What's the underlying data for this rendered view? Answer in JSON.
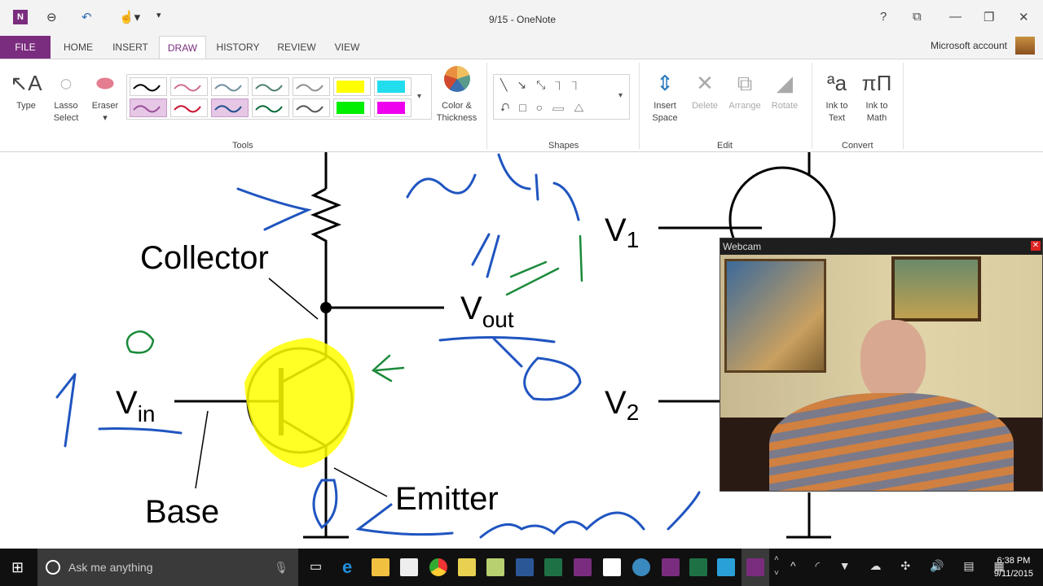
{
  "titlebar": {
    "title": "9/15 - OneNote",
    "help": "?",
    "account": "Microsoft account"
  },
  "tabs": [
    "FILE",
    "HOME",
    "INSERT",
    "DRAW",
    "HISTORY",
    "REVIEW",
    "VIEW"
  ],
  "ribbon": {
    "type": "Type",
    "lasso": "Lasso Select",
    "eraser": "Eraser",
    "color_thickness": "Color & Thickness",
    "insert_space": "Insert Space",
    "delete": "Delete",
    "arrange": "Arrange",
    "rotate": "Rotate",
    "ink_to_text": "Ink to Text",
    "ink_to_math": "Ink to Math",
    "groups": {
      "tools": "Tools",
      "shapes": "Shapes",
      "edit": "Edit",
      "convert": "Convert"
    },
    "pen_colors": [
      "#000000",
      "#d07090",
      "#7090a0",
      "#508070",
      "#909090",
      "#ffff00",
      "#22ddee",
      "#9b4f9b",
      "#cc1030",
      "#1f4e8c",
      "#0a6a3a",
      "#555555",
      "#00ee00",
      "#ee00ee"
    ]
  },
  "diagram": {
    "collector": "Collector",
    "vout_v": "V",
    "vout_sub": "out",
    "vin_v": "V",
    "vin_sub": "in",
    "base": "Base",
    "emitter": "Emitter",
    "v1_v": "V",
    "v1_sub": "1",
    "v2_v": "V",
    "v2_sub": "2"
  },
  "webcam": {
    "title": "Webcam"
  },
  "taskbar": {
    "search_placeholder": "Ask me anything",
    "time": "6:38 PM",
    "date": "9/11/2015"
  }
}
